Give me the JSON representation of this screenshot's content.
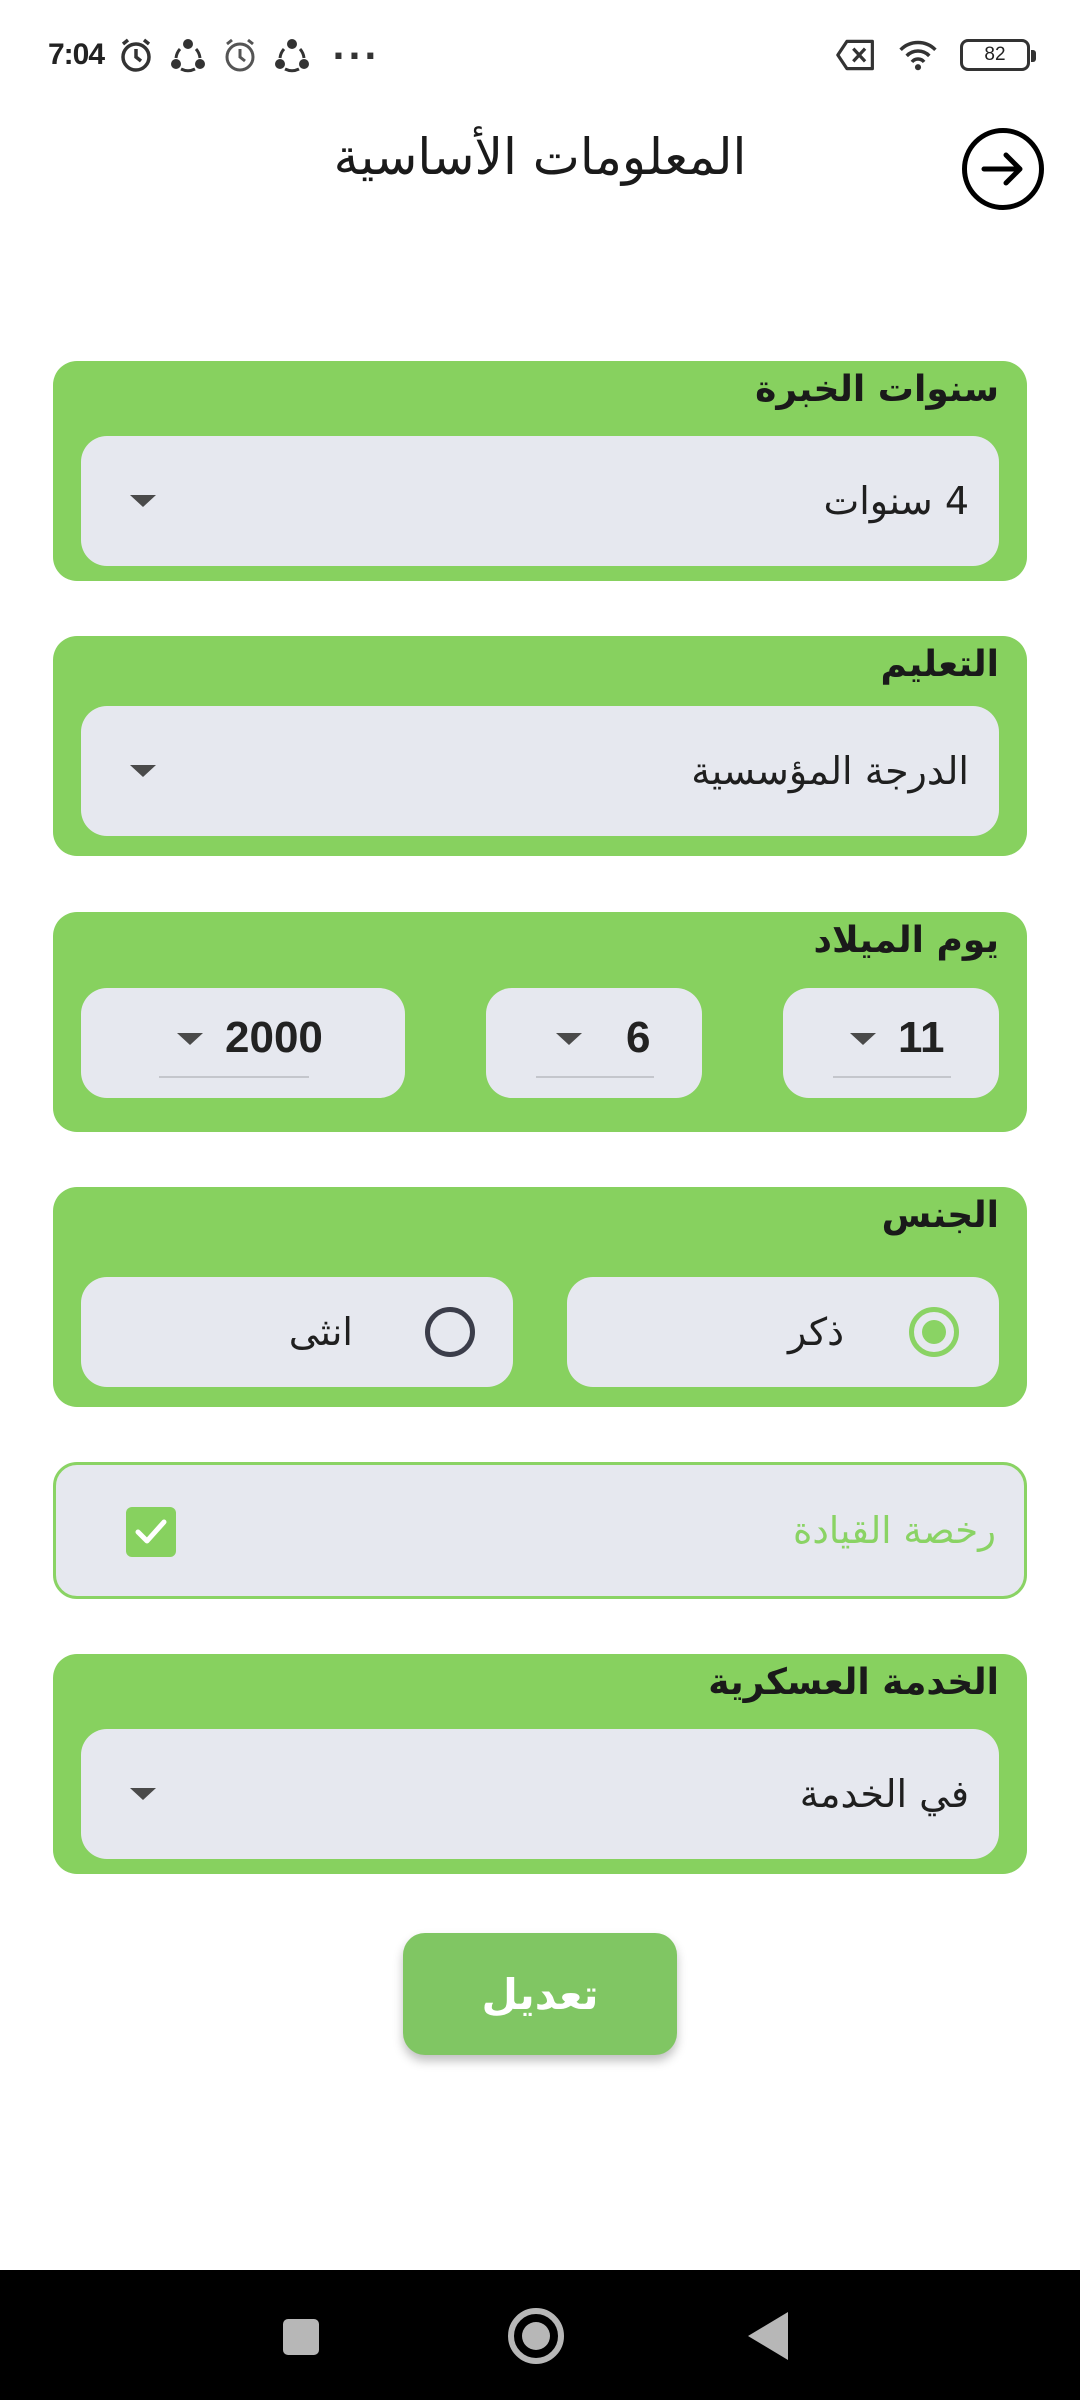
{
  "status_bar": {
    "time": "7:04",
    "battery": "82",
    "icons": [
      "heart-icon",
      "alarm-icon",
      "share-icon",
      "alarm-icon",
      "share-icon",
      "more-icon",
      "no-sim-icon",
      "wifi-icon",
      "battery-icon"
    ]
  },
  "header": {
    "title": "المعلومات الأساسية",
    "back_icon": "arrow-right-circle-icon"
  },
  "experience": {
    "label": "سنوات الخبرة",
    "value": "4 سنوات"
  },
  "education": {
    "label": "التعليم",
    "value": "الدرجة المؤسسية"
  },
  "birthday": {
    "label": "يوم الميلاد",
    "day": "11",
    "month": "6",
    "year": "2000"
  },
  "gender": {
    "label": "الجنس",
    "male": "ذكر",
    "female": "انثى",
    "selected": "male"
  },
  "license": {
    "label": "رخصة القيادة",
    "checked": true
  },
  "military": {
    "label": "الخدمة العسكرية",
    "value": "في الخدمة"
  },
  "edit_button": "تعديل",
  "colors": {
    "accent": "#87d15f",
    "field": "#e6e8ef",
    "button": "#80c663"
  },
  "nav_bar": {
    "icons": [
      "recents-icon",
      "home-icon",
      "back-icon"
    ]
  }
}
